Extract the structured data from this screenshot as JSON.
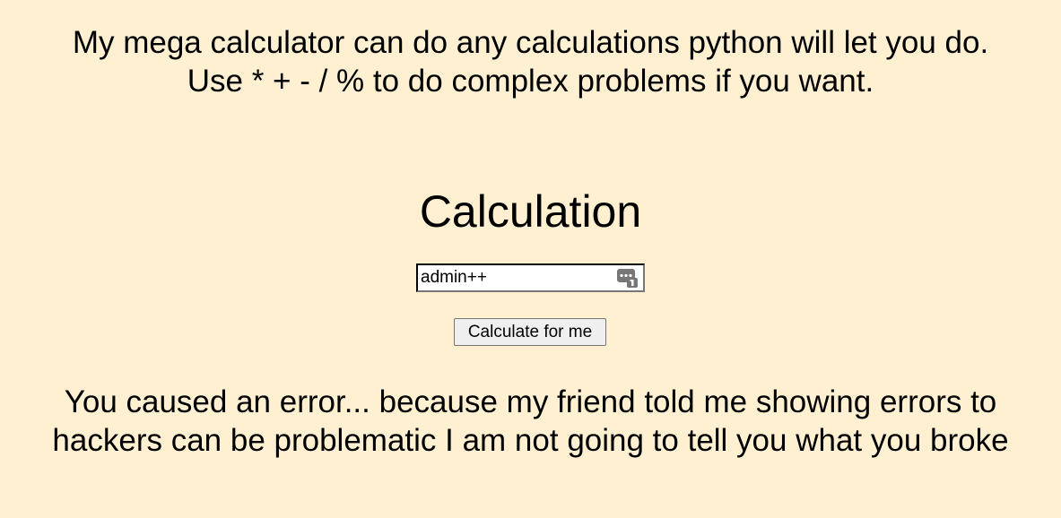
{
  "intro": {
    "line1": "My mega calculator can do any calculations python will let you do.",
    "line2": "Use * + - / % to do complex problems if you want."
  },
  "form": {
    "heading": "Calculation",
    "input_value": "admin++",
    "input_icon": "password-manager-key-icon",
    "button_label": "Calculate for me"
  },
  "result": {
    "message": "You caused an error... because my friend told me showing errors to hackers can be problematic I am not going to tell you what you broke"
  },
  "colors": {
    "background": "#fff0d1",
    "button_bg": "#efefef"
  }
}
